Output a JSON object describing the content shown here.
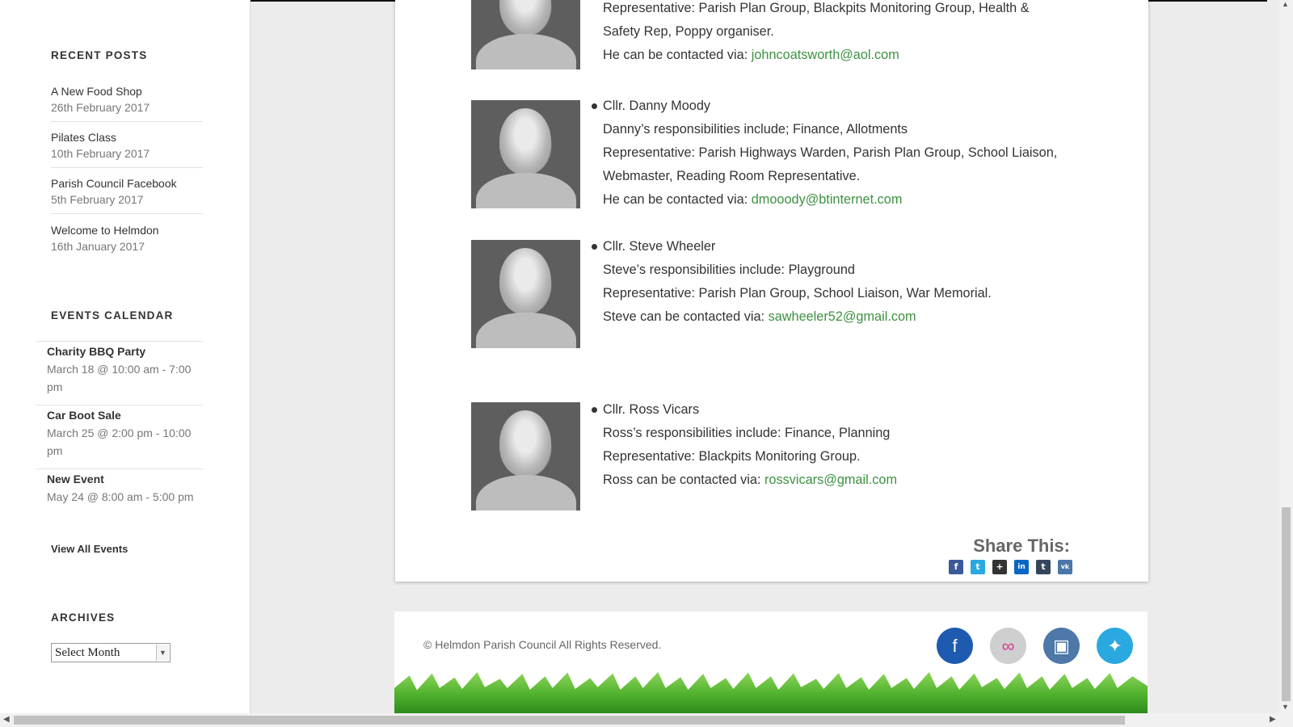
{
  "sidebar": {
    "recent_posts_title": "RECENT POSTS",
    "posts": [
      {
        "title": "A New Food Shop",
        "date": "26th February 2017"
      },
      {
        "title": "Pilates Class",
        "date": "10th February 2017"
      },
      {
        "title": "Parish Council Facebook",
        "date": "5th February 2017"
      },
      {
        "title": "Welcome to Helmdon",
        "date": "16th January 2017"
      }
    ],
    "events_title": "EVENTS CALENDAR",
    "events": [
      {
        "title": "Charity BBQ Party",
        "time": "March 18 @ 10:00 am - 7:00 pm"
      },
      {
        "title": "Car Boot Sale",
        "time": "March 25 @ 2:00 pm - 10:00 pm"
      },
      {
        "title": "New Event",
        "time": "May 24 @ 8:00 am - 5:00 pm"
      }
    ],
    "view_all_events": "View All Events",
    "archives_title": "ARCHIVES",
    "archives_select": "Select Month"
  },
  "members": [
    {
      "lines": [
        "Representative: Parish Plan Group, Blackpits Monitoring Group, Health &",
        "Safety Rep, Poppy organiser."
      ],
      "contact_prefix": "He can be contacted via: ",
      "email": "johncoatsworth@aol.com"
    },
    {
      "name": "Cllr. Danny Moody",
      "lines": [
        "Danny’s responsibilities include; Finance, Allotments",
        "Representative: Parish Highways Warden, Parish Plan Group, School Liaison,",
        "Webmaster, Reading Room Representative."
      ],
      "contact_prefix": "He can be contacted via: ",
      "email": "dmooody@btinternet.com"
    },
    {
      "name": "Cllr. Steve Wheeler",
      "lines": [
        "Steve’s responsibilities include: Playground",
        "Representative: Parish Plan Group, School Liaison, War Memorial."
      ],
      "contact_prefix": "Steve can be contacted via: ",
      "email": "sawheeler52@gmail.com"
    },
    {
      "name": "Cllr. Ross Vicars",
      "lines": [
        "Ross’s responsibilities include: Finance, Planning",
        "Representative: Blackpits Monitoring Group."
      ],
      "contact_prefix": "Ross can be contacted via: ",
      "email": "rossvicars@gmail.com"
    }
  ],
  "share": {
    "title": "Share This:",
    "icons": [
      {
        "icon": "facebook-icon",
        "glyph": "f",
        "color": "#3b5998"
      },
      {
        "icon": "twitter-icon",
        "glyph": "t",
        "color": "#2aa9e0"
      },
      {
        "icon": "add-icon",
        "glyph": "+",
        "color": "#333333"
      },
      {
        "icon": "linkedin-icon",
        "glyph": "in",
        "color": "#0a66c2"
      },
      {
        "icon": "tumblr-icon",
        "glyph": "t",
        "color": "#35465c"
      },
      {
        "icon": "vk-icon",
        "glyph": "vk",
        "color": "#4a76a8"
      }
    ]
  },
  "footer": {
    "copyright": "© Helmdon Parish Council All Rights Reserved.",
    "social": [
      {
        "icon": "facebook-icon",
        "glyph": "f",
        "color": "#1e5bb0"
      },
      {
        "icon": "flickr-icon",
        "glyph": "∞",
        "color": "#cfcfcf"
      },
      {
        "icon": "instagram-icon",
        "glyph": "▣",
        "color": "#4d78a8"
      },
      {
        "icon": "twitter-icon",
        "glyph": "✦",
        "color": "#2aa9e0"
      }
    ]
  }
}
